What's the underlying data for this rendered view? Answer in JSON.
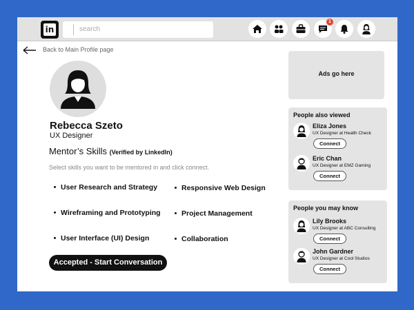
{
  "header": {
    "logo_text": "in",
    "search_placeholder": "search",
    "notification_count": "1",
    "icons": [
      "home-icon",
      "network-icon",
      "jobs-icon",
      "messaging-icon",
      "notifications-icon",
      "profile-icon"
    ]
  },
  "back_link": "Back to Main Profile page",
  "profile": {
    "name": "Rebecca Szeto",
    "title": "UX Designer"
  },
  "skills": {
    "heading": "Mentor’s Skills",
    "verified": "(Verified by LinkedIn)",
    "instruction": "Select skills you want to be mentored in and click connect.",
    "items": [
      "User Research and Strategy",
      "Responsive Web Design",
      "Wireframing and Prototyping",
      "Project Management",
      "User Interface (UI) Design",
      "Collaboration"
    ]
  },
  "cta_label": "Accepted - Start Conversation",
  "ads_text": "Ads go here",
  "people_also_viewed": {
    "title": "People also viewed",
    "people": [
      {
        "name": "Eliza Jones",
        "role": "UX Designer at Health Check",
        "button": "Connect"
      },
      {
        "name": "Eric Chan",
        "role": "UX Designer at EMZ Gaming",
        "button": "Connect"
      }
    ]
  },
  "people_you_may_know": {
    "title": "People you may know",
    "people": [
      {
        "name": "Lily Brooks",
        "role": "UX Designer at ABC Consulting",
        "button": "Connect"
      },
      {
        "name": "John Gardner",
        "role": "UX Designer at Cool Studios",
        "button": "Connect"
      }
    ]
  },
  "colors": {
    "background": "#2f68c8",
    "topbar": "#e2e2e2",
    "panel": "#e4e4e4",
    "badge": "#e0452e",
    "button_dark": "#111111"
  }
}
